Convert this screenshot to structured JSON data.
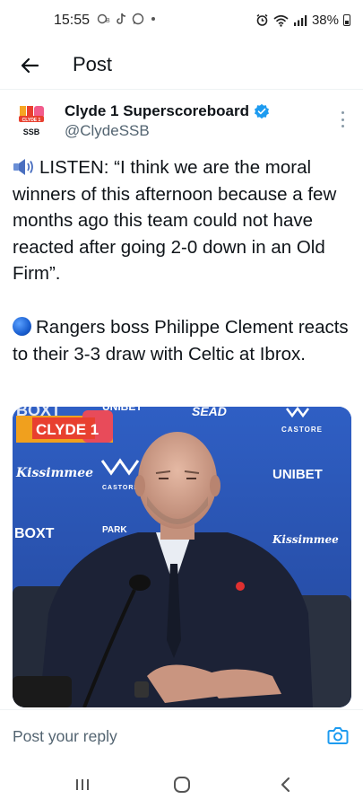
{
  "status": {
    "time": "15:55",
    "battery": "38%",
    "left_icons": [
      "data-saver-icon",
      "tiktok-icon",
      "whatsapp-icon",
      "dot-icon"
    ],
    "right_icons": [
      "alarm-icon",
      "wifi-icon",
      "signal-icon",
      "battery-icon"
    ]
  },
  "header": {
    "title": "Post"
  },
  "tweet": {
    "display_name": "Clyde 1 Superscoreboard",
    "handle": "@ClydeSSB",
    "verified": true,
    "avatar_text_top": "CLYDE 1",
    "avatar_text_bottom": "SSB",
    "text_p1": "LISTEN: “I think we are the moral winners of this afternoon because a few months ago this team could not have reacted after going 2-0 down in an Old Firm”.",
    "text_p2": "Rangers boss Philippe Clement reacts to their 3-3 draw with Celtic at Ibrox."
  },
  "media": {
    "logo_text": "CLYDE 1",
    "sponsor_boxt": "BOXT",
    "sponsor_unibet": "UNIBET",
    "sponsor_castore": "CASTORE",
    "sponsor_kissimmee": "Kissimmee",
    "sponsor_sead": "SEAD",
    "sponsor_park": "PARK"
  },
  "reply": {
    "placeholder": "Post your reply"
  },
  "colors": {
    "accent": "#1d9bf0",
    "text": "#0f1419",
    "muted": "#536471",
    "backdrop_blue": "#2d5ab8"
  }
}
